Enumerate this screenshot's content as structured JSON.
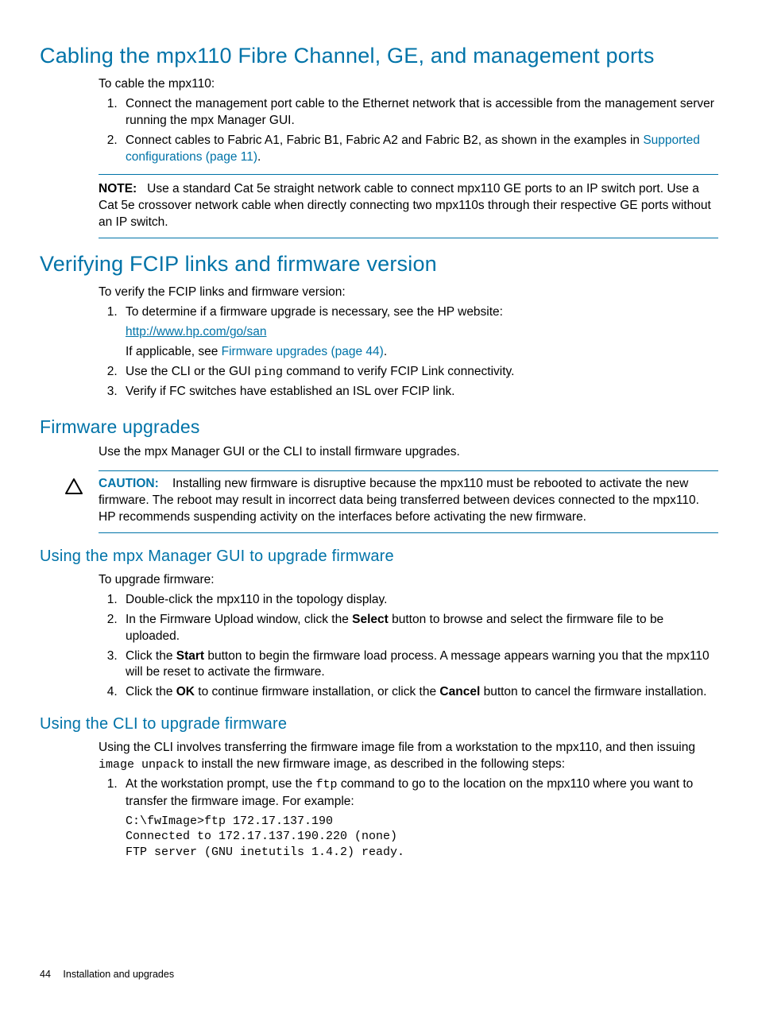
{
  "s1": {
    "heading": "Cabling the mpx110 Fibre Channel, GE, and management ports",
    "intro": "To cable the mpx110:",
    "li1": "Connect the management port cable to the Ethernet network that is accessible from the management server running the mpx Manager GUI.",
    "li2a": "Connect cables to Fabric A1, Fabric B1, Fabric A2 and Fabric B2, as shown in the examples in ",
    "li2link": "Supported configurations (page 11)",
    "li2b": ".",
    "noteLabel": "NOTE:",
    "noteText": "Use a standard Cat 5e straight network cable to connect mpx110 GE ports to an IP switch port. Use a Cat 5e crossover network cable when directly connecting two mpx110s through their respective GE ports without an IP switch."
  },
  "s2": {
    "heading": "Verifying FCIP links and firmware version",
    "intro": "To verify the FCIP links and firmware version:",
    "li1a": "To determine if a firmware upgrade is necessary, see the HP website:",
    "li1link": "http://www.hp.com/go/san",
    "li1b1": "If applicable, see ",
    "li1b2": "Firmware upgrades (page 44)",
    "li1b3": ".",
    "li2a": "Use the CLI or the GUI ",
    "li2code": "ping",
    "li2b": " command to verify FCIP Link connectivity.",
    "li3": "Verify if FC switches have established an ISL over FCIP link."
  },
  "s3": {
    "heading": "Firmware upgrades",
    "intro": "Use the mpx Manager GUI or the CLI to install firmware upgrades.",
    "cautionLabel": "CAUTION:",
    "cautionText": "Installing new firmware is disruptive because the mpx110 must be rebooted to activate the new firmware. The reboot may result in incorrect data being transferred between devices connected to the mpx110. HP recommends suspending activity on the interfaces before activating the new firmware."
  },
  "s4": {
    "heading": "Using the mpx Manager GUI to upgrade firmware",
    "intro": "To upgrade firmware:",
    "li1": "Double-click the mpx110 in the topology display.",
    "li2a": "In the Firmware Upload window, click the ",
    "li2bold": "Select",
    "li2b": " button to browse and select the firmware file to be uploaded.",
    "li3a": "Click the ",
    "li3bold": "Start",
    "li3b": " button to begin the firmware load process. A message appears warning you that the mpx110 will be reset to activate the firmware.",
    "li4a": "Click the ",
    "li4bold1": "OK",
    "li4b": " to continue firmware installation, or click the ",
    "li4bold2": "Cancel",
    "li4c": " button to cancel the firmware installation."
  },
  "s5": {
    "heading": "Using the CLI to upgrade firmware",
    "p1a": "Using the CLI involves transferring the firmware image file from a workstation to the mpx110, and then issuing ",
    "p1code": "image unpack",
    "p1b": " to install the new firmware image, as described in the following steps:",
    "li1a": "At the workstation prompt, use the ",
    "li1code": "ftp",
    "li1b": " command to go to the location on the mpx110 where you want to transfer the firmware image. For example:",
    "code": "C:\\fwImage>ftp 172.17.137.190\nConnected to 172.17.137.190.220 (none)\nFTP server (GNU inetutils 1.4.2) ready."
  },
  "footer": {
    "page": "44",
    "section": "Installation and upgrades"
  }
}
